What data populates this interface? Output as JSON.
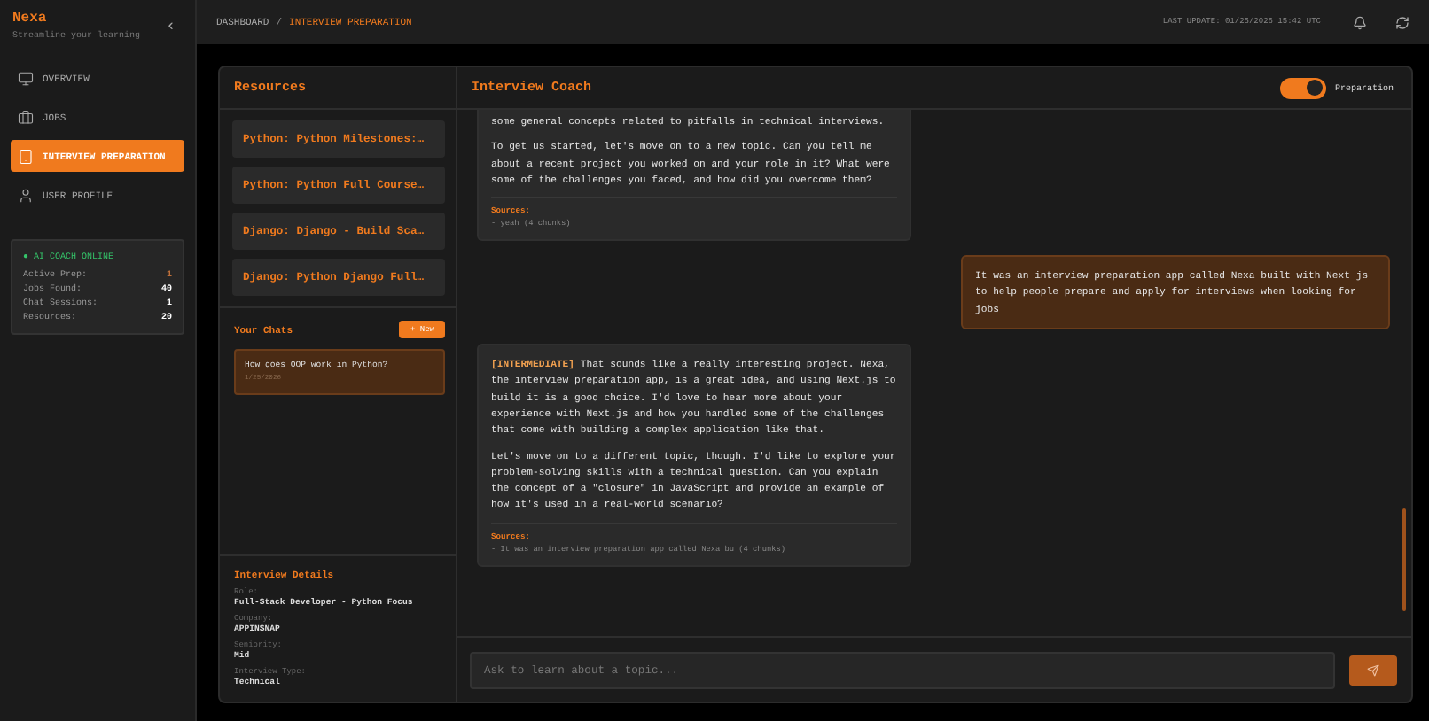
{
  "sidebar": {
    "brand": "Nexa",
    "tagline": "Streamline your learning",
    "collapse_icon": "‹",
    "items": [
      {
        "label": "OVERVIEW",
        "kind": "monitor",
        "selected": false
      },
      {
        "label": "JOBS",
        "kind": "briefcase",
        "selected": false
      },
      {
        "label": "INTERVIEW PREPARATION",
        "kind": "tablet",
        "selected": true
      },
      {
        "label": "USER PROFILE",
        "kind": "user",
        "selected": false
      }
    ],
    "status": {
      "title": "● AI COACH ONLINE",
      "stats": [
        {
          "label": "Active Prep:",
          "value": "1",
          "color": "#c0703a"
        },
        {
          "label": "Jobs Found:",
          "value": "40",
          "color": "#ffffff"
        },
        {
          "label": "Chat Sessions:",
          "value": "1",
          "color": "#ffffff"
        },
        {
          "label": "Resources:",
          "value": "20",
          "color": "#ffffff"
        }
      ]
    }
  },
  "topbar": {
    "breadcrumb": [
      "DASHBOARD",
      "INTERVIEW PREPARATION"
    ],
    "separator": "/",
    "last_update": "LAST UPDATE: 01/25/2026 15:42 UTC"
  },
  "resources": {
    "title": "Resources",
    "items": [
      "Python: Python Milestones:…",
      "Python: Python Full Course…",
      "Django: Django - Build Sca…",
      "Django: Python Django Full…"
    ]
  },
  "chats": {
    "title": "Your Chats",
    "new_button": "+ New",
    "items": [
      {
        "title": "How does OOP work in Python?",
        "date": "1/25/2026",
        "selected": true
      }
    ]
  },
  "interview_details": {
    "title": "Interview Details",
    "fields": [
      {
        "label": "Role:",
        "value": "Full-Stack Developer - Python Focus"
      },
      {
        "label": "Company:",
        "value": "APPINSNAP"
      },
      {
        "label": "Seniority:",
        "value": "Mid"
      },
      {
        "label": "Interview Type:",
        "value": "Technical"
      }
    ]
  },
  "coach": {
    "title": "Interview Coach",
    "mode_toggle": {
      "label": "Preparation",
      "on": true
    },
    "messages": [
      {
        "kind": "assistant",
        "paragraphs": [
          "some general concepts related to pitfalls in technical interviews.",
          "To get us started, let's move on to a new topic. Can you tell me about a recent project you worked on and your role in it? What were some of the challenges you faced, and how did you overcome them?"
        ],
        "sources_label": "Sources:",
        "sources": [
          "- yeah (4 chunks)"
        ]
      },
      {
        "kind": "user",
        "paragraphs": [
          "It was an interview preparation app called Nexa built with Next js to help people prepare and apply for interviews when looking for jobs"
        ]
      },
      {
        "kind": "assistant",
        "paragraphs": [
          "**[INTERMEDIATE]** That sounds like a really interesting project. Nexa, the interview preparation app, is a great idea, and using Next.js to build it is a good choice. I'd love to hear more about your experience with Next.js and how you handled some of the challenges that come with building a complex application like that.",
          "Let's move on to a different topic, though. I'd like to explore your problem-solving skills with a technical question. Can you explain the concept of a \"closure\" in JavaScript and provide an example of how it's used in a real-world scenario?"
        ],
        "sources_label": "Sources:",
        "sources": [
          "- It was an interview preparation app called Nexa bu (4 chunks)"
        ]
      }
    ],
    "input": {
      "placeholder": "Ask to learn about a topic..."
    }
  }
}
